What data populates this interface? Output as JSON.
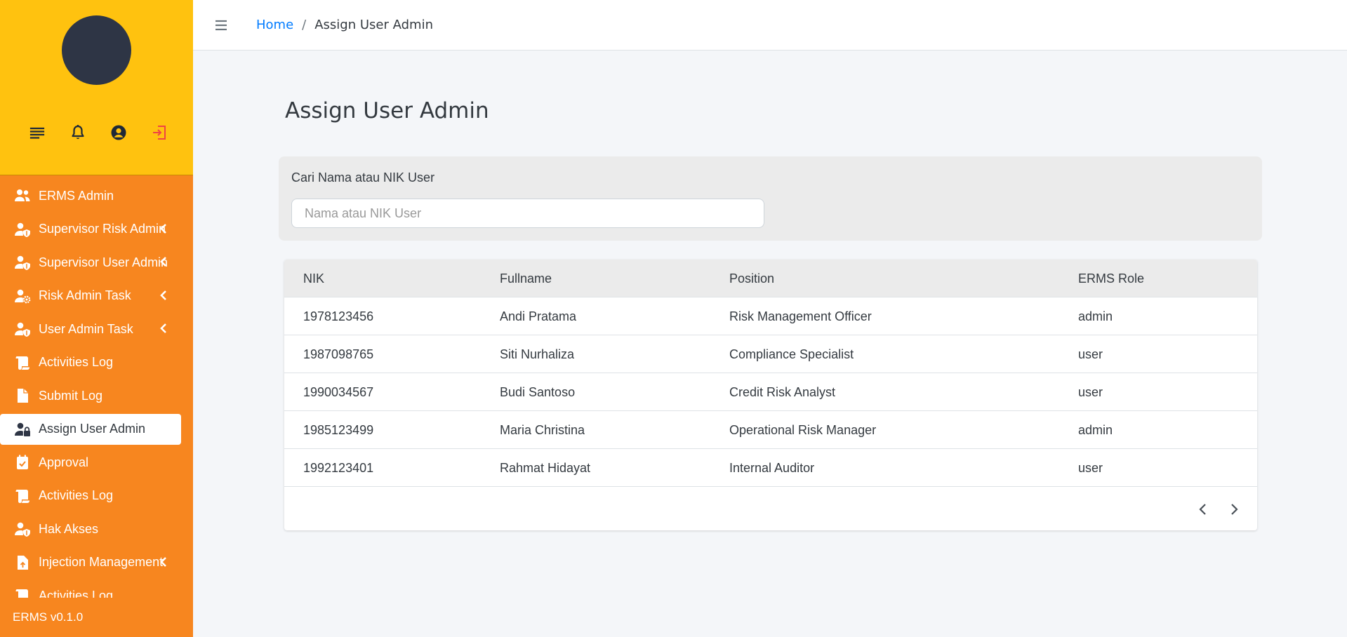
{
  "sidebar": {
    "top_icons": [
      {
        "name": "menu-lines-icon",
        "color": "#1f2937"
      },
      {
        "name": "bell-icon",
        "color": "#1f2937"
      },
      {
        "name": "user-circle-icon",
        "color": "#1f2937"
      },
      {
        "name": "logout-icon",
        "color": "#ef4444"
      }
    ],
    "items": [
      {
        "label": "ERMS Admin",
        "icon": "users-icon",
        "has_chevron": false
      },
      {
        "label": "Supervisor Risk Admin",
        "icon": "user-shield-icon",
        "has_chevron": true
      },
      {
        "label": "Supervisor User Admin",
        "icon": "user-shield-icon",
        "has_chevron": true
      },
      {
        "label": "Risk Admin Task",
        "icon": "user-gear-icon",
        "has_chevron": true
      },
      {
        "label": "User Admin Task",
        "icon": "user-shield-icon",
        "has_chevron": true
      },
      {
        "label": "Activities Log",
        "icon": "scroll-icon",
        "has_chevron": false
      },
      {
        "label": "Submit Log",
        "icon": "file-icon",
        "has_chevron": false
      },
      {
        "label": "Assign User Admin",
        "icon": "user-lock-icon",
        "has_chevron": false,
        "active": true
      },
      {
        "label": "Approval",
        "icon": "calendar-check-icon",
        "has_chevron": false
      },
      {
        "label": "Activities Log",
        "icon": "scroll-icon",
        "has_chevron": false
      },
      {
        "label": "Hak Akses",
        "icon": "user-shield-icon",
        "has_chevron": false
      },
      {
        "label": "Injection Management",
        "icon": "file-upload-icon",
        "has_chevron": true
      },
      {
        "label": "Activities Log",
        "icon": "scroll-icon",
        "has_chevron": false
      }
    ],
    "version": "ERMS v0.1.0"
  },
  "topbar": {
    "breadcrumb_home": "Home",
    "breadcrumb_sep": "/",
    "breadcrumb_current": "Assign User Admin"
  },
  "main": {
    "title": "Assign User Admin",
    "search": {
      "label": "Cari Nama atau NIK User",
      "placeholder": "Nama atau NIK User",
      "value": ""
    },
    "table": {
      "headers": [
        "NIK",
        "Fullname",
        "Position",
        "ERMS Role"
      ],
      "rows": [
        [
          "1978123456",
          "Andi Pratama",
          "Risk Management Officer",
          "admin"
        ],
        [
          "1987098765",
          "Siti Nurhaliza",
          "Compliance Specialist",
          "user"
        ],
        [
          "1990034567",
          "Budi Santoso",
          "Credit Risk Analyst",
          "user"
        ],
        [
          "1985123499",
          "Maria Christina",
          "Operational Risk Manager",
          "admin"
        ],
        [
          "1992123401",
          "Rahmat Hidayat",
          "Internal Auditor",
          "user"
        ]
      ]
    }
  },
  "colors": {
    "sidebar_top": "#ffc20f",
    "sidebar_menu": "#f7861f",
    "link": "#007bff"
  }
}
